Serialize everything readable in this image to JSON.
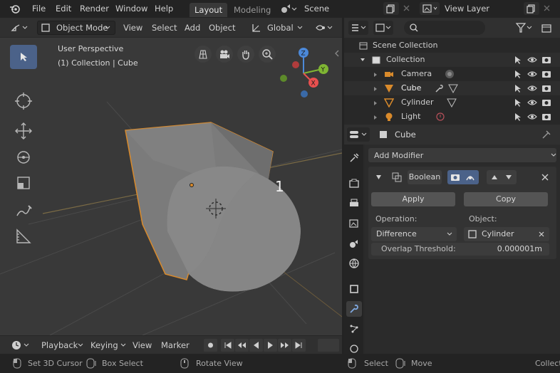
{
  "topbar": {
    "menus": [
      "File",
      "Edit",
      "Render",
      "Window",
      "Help"
    ],
    "tabs": [
      {
        "label": "Layout",
        "active": true
      },
      {
        "label": "Modeling",
        "active": false
      }
    ],
    "scene_label": "Scene",
    "view_layer_label": "View Layer"
  },
  "viewport_header": {
    "mode": "Object Mode",
    "menus": [
      "View",
      "Select",
      "Add",
      "Object"
    ],
    "transform_orientation": "Global"
  },
  "viewport": {
    "perspective_label": "User Perspective",
    "collection_label": "(1) Collection | Cube",
    "annotation": "1",
    "gizmo_axes": [
      "Z",
      "Y",
      "X"
    ]
  },
  "outliner": {
    "scene_collection": "Scene Collection",
    "collection": "Collection",
    "items": [
      {
        "label": "Camera",
        "type": "camera"
      },
      {
        "label": "Cube",
        "type": "mesh"
      },
      {
        "label": "Cylinder",
        "type": "mesh"
      },
      {
        "label": "Light",
        "type": "light"
      }
    ]
  },
  "properties": {
    "object_name": "Cube",
    "add_modifier": "Add Modifier",
    "modifier": {
      "name": "Boolean",
      "apply_label": "Apply",
      "copy_label": "Copy",
      "operation_label": "Operation:",
      "operation_value": "Difference",
      "object_label": "Object:",
      "object_value": "Cylinder",
      "overlap_label": "Overlap Threshold:",
      "overlap_value": "0.000001m"
    }
  },
  "timeline": {
    "menus": [
      "Playback",
      "Keying",
      "View",
      "Marker"
    ]
  },
  "statusbar": {
    "items": [
      "Set 3D Cursor",
      "Box Select",
      "Rotate View",
      "Select",
      "Move",
      "Collect"
    ]
  },
  "colors": {
    "accent_blue": "#4b6289",
    "selection_orange": "#d98a2b",
    "axis_x": "#e8504f",
    "axis_y": "#7fb533",
    "axis_z": "#4c89d9"
  }
}
